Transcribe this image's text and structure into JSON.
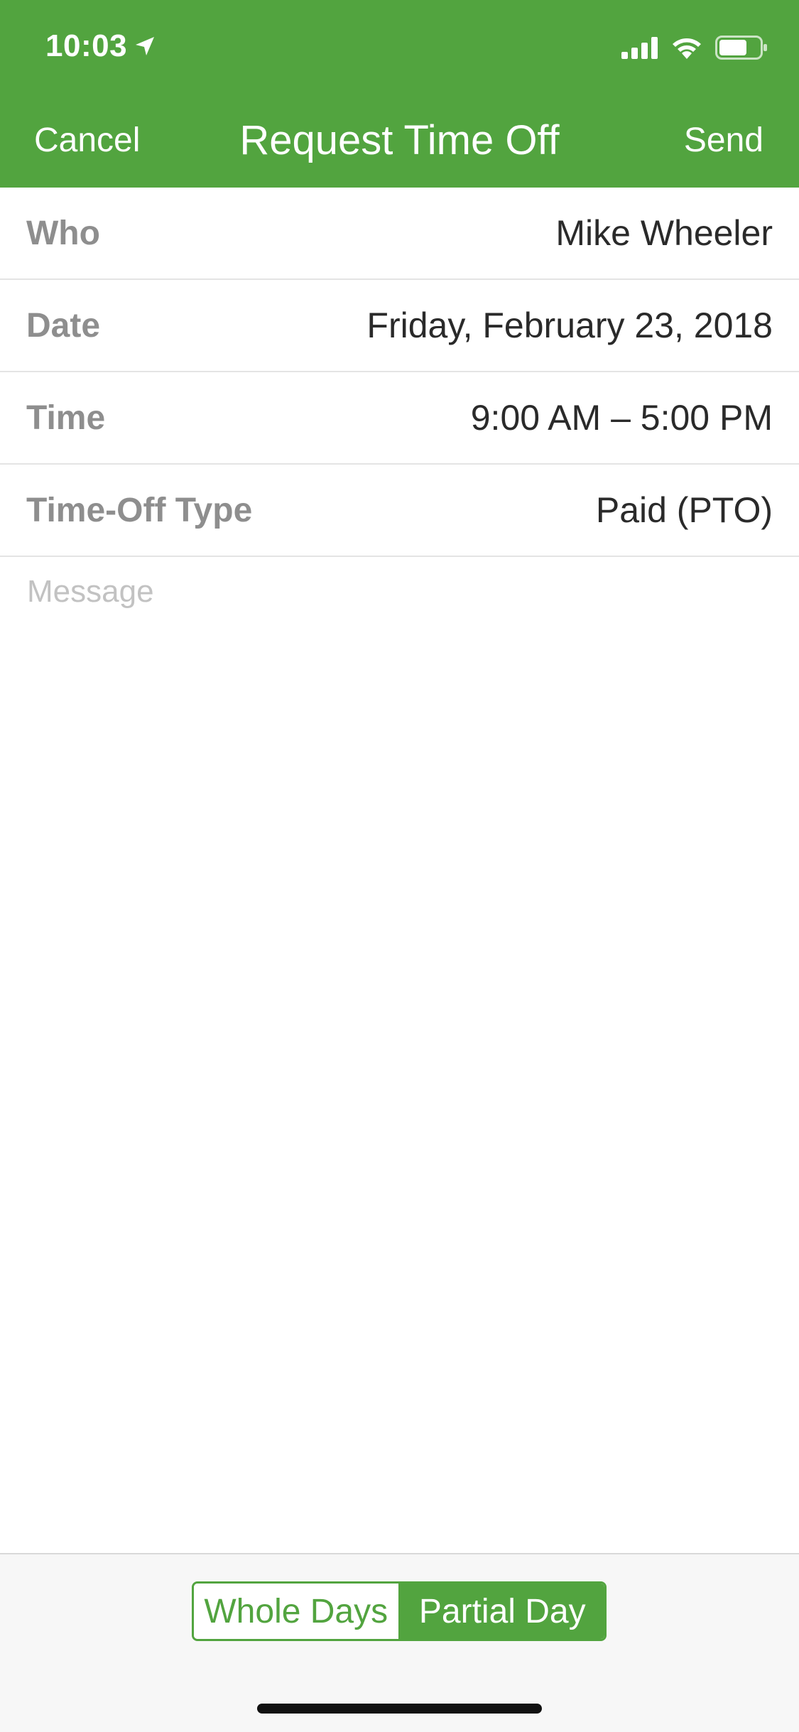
{
  "status_bar": {
    "time": "10:03",
    "icons": [
      "location-arrow-icon",
      "cellular-signal-icon",
      "wifi-icon",
      "battery-icon"
    ]
  },
  "nav": {
    "cancel_label": "Cancel",
    "title": "Request Time Off",
    "send_label": "Send"
  },
  "form": {
    "rows": [
      {
        "label": "Who",
        "value": "Mike Wheeler"
      },
      {
        "label": "Date",
        "value": "Friday, February 23, 2018"
      },
      {
        "label": "Time",
        "value": "9:00 AM – 5:00 PM"
      },
      {
        "label": "Time-Off Type",
        "value": "Paid (PTO)"
      }
    ],
    "message_placeholder": "Message"
  },
  "toggle": {
    "options": [
      "Whole Days",
      "Partial Day"
    ],
    "selected": "Partial Day"
  },
  "colors": {
    "accent": "#52a43f",
    "label_gray": "#8e8e8e",
    "value_text": "#2a2a2a",
    "placeholder": "#c2c2c2"
  }
}
